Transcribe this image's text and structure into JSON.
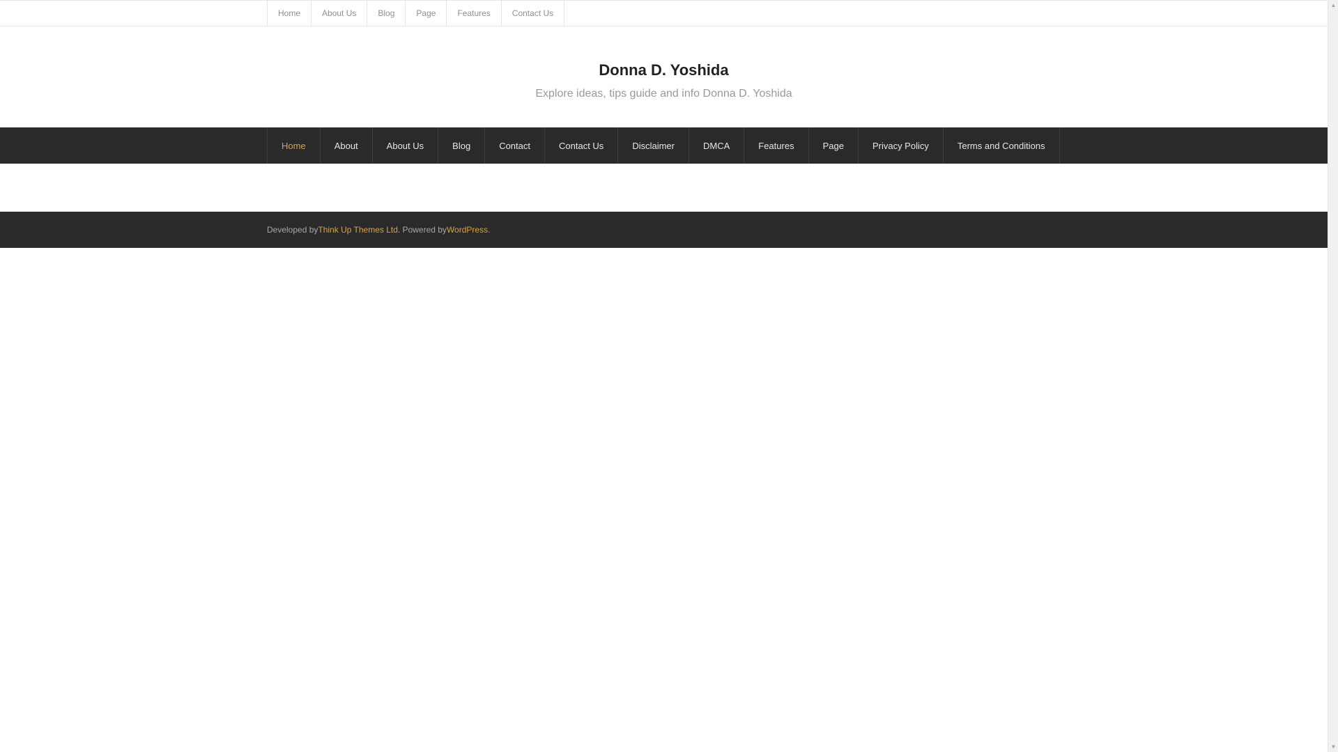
{
  "top_menu": {
    "items": [
      {
        "label": "Home"
      },
      {
        "label": "About Us"
      },
      {
        "label": "Blog"
      },
      {
        "label": "Page"
      },
      {
        "label": "Features"
      },
      {
        "label": "Contact Us"
      }
    ]
  },
  "header": {
    "title": "Donna D. Yoshida",
    "tagline": "Explore ideas, tips guide and info Donna D. Yoshida"
  },
  "main_menu": {
    "items": [
      {
        "label": "Home"
      },
      {
        "label": "About"
      },
      {
        "label": "About Us"
      },
      {
        "label": "Blog"
      },
      {
        "label": "Contact"
      },
      {
        "label": "Contact Us"
      },
      {
        "label": "Disclaimer"
      },
      {
        "label": "DMCA"
      },
      {
        "label": "Features"
      },
      {
        "label": "Page"
      },
      {
        "label": "Privacy Policy"
      },
      {
        "label": "Terms and Conditions"
      }
    ]
  },
  "footer": {
    "developed_by": "Developed by ",
    "developer_link": "Think Up Themes Ltd",
    "powered_by": ". Powered by ",
    "powered_link": "WordPress",
    "end": "."
  },
  "colors": {
    "accent": "#d8a444",
    "nav_bg": "#2a2a2a"
  },
  "icons": {
    "scroll_up": "triangle-up-icon",
    "scroll_down": "triangle-down-icon"
  }
}
